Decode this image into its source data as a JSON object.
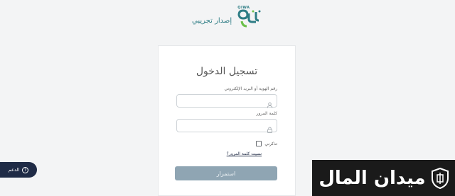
{
  "logo": {
    "brand": "QIWA",
    "subtitle": "إصدار تجريبي"
  },
  "login": {
    "title": "تسجيل الدخول",
    "id_label": "رقم الهوية أو البريد الإلكتروني",
    "id_value": "",
    "password_label": "كلمة المرور",
    "password_value": "",
    "remember_label": "تذكرني",
    "forgot_label": "نسيت كلمة المرور؟",
    "submit_label": "استمرار"
  },
  "support": {
    "label": "الدعم",
    "icon_glyph": "?"
  },
  "watermark": {
    "text": "ميدان المال"
  },
  "colors": {
    "brand_teal": "#2e7d85",
    "brand_green": "#6cc04a",
    "submit_bg": "#8fa5b3",
    "support_bg": "#1f2b46",
    "watermark_bg": "#1a1a1a"
  }
}
